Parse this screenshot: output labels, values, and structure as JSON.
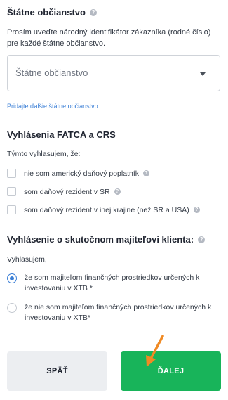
{
  "citizenship": {
    "title": "Štátne občianstvo",
    "description": "Prosím uveďte národný identifikátor zákazníka (rodné číslo) pre každé štátne občianstvo.",
    "select_placeholder": "Štátne občianstvo",
    "add_link": "Pridajte ďalšie štátne občianstvo"
  },
  "fatca": {
    "title": "Vyhlásenia FATCA a CRS",
    "intro": "Týmto vyhlasujem, že:",
    "options": [
      {
        "label": "nie som americký daňový poplatník",
        "checked": false
      },
      {
        "label": "som daňový rezident v SR",
        "checked": false
      },
      {
        "label": "som daňový rezident v inej krajine (než SR a USA)",
        "checked": false
      }
    ]
  },
  "owner": {
    "title": "Vyhlásenie o skutočnom majiteľovi klienta:",
    "intro": "Vyhlasujem,",
    "options": [
      {
        "label": "že som majiteľom finančných prostriedkov určených k investovaniu v XTB *",
        "selected": true
      },
      {
        "label": "že nie som majiteľom finančných prostriedkov určených k investovaniu v XTB*",
        "selected": false
      }
    ]
  },
  "buttons": {
    "back": "SPÄŤ",
    "next": "ĎALEJ"
  },
  "colors": {
    "primary_green": "#18b45a",
    "link_blue": "#3b7fd6",
    "arrow_orange": "#f08a24"
  },
  "icons": {
    "help": "question-circle-icon",
    "dropdown": "chevron-down-icon",
    "pointer": "arrow-icon"
  }
}
